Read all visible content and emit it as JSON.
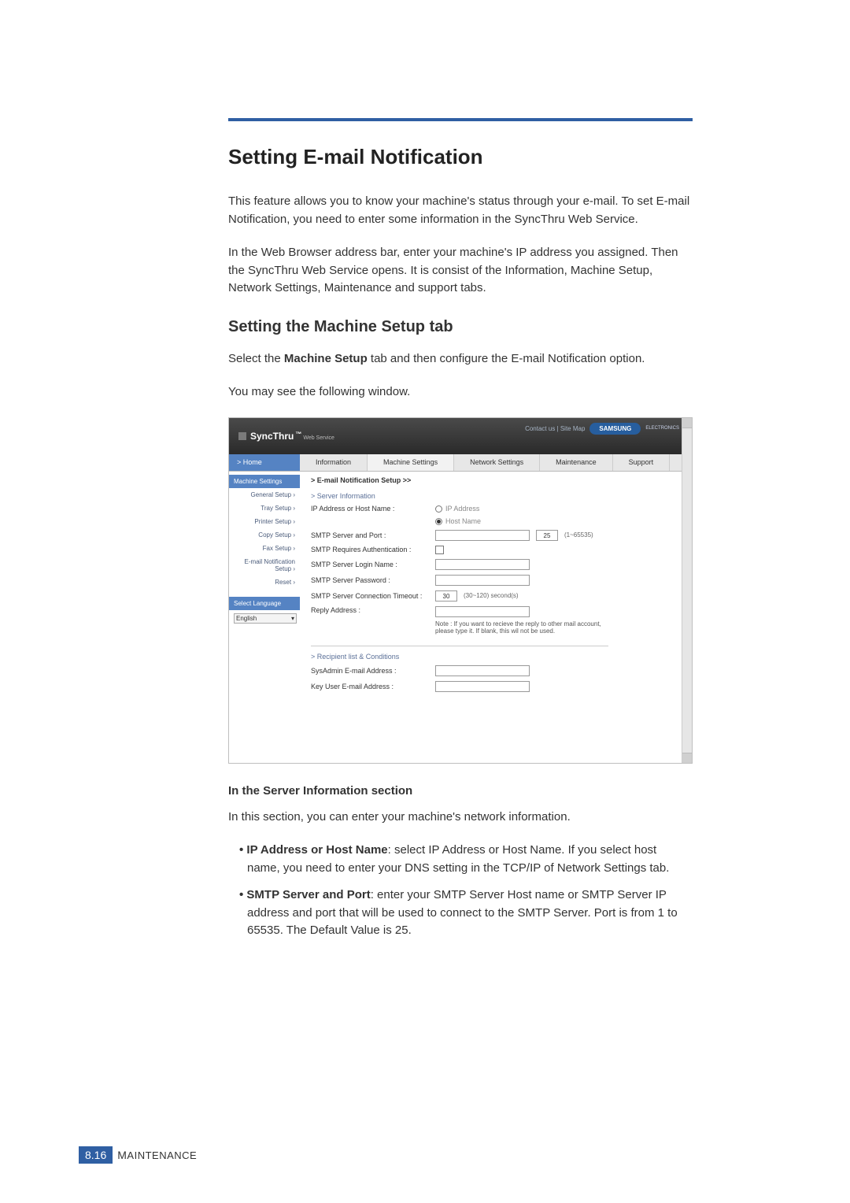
{
  "page": {
    "title": "Setting E-mail Notification",
    "intro1": "This feature allows you to know your machine's status through your e-mail. To set E-mail Notification, you need to enter some information in the SyncThru Web Service.",
    "intro2": "In the Web Browser address bar, enter your machine's IP address you assigned. Then the SyncThru Web Service opens. It is consist of the Information, Machine Setup, Network Settings, Maintenance and support tabs.",
    "section_title": "Setting the Machine Setup tab",
    "section_p1_a": "Select the ",
    "section_p1_b": "Machine Setup",
    "section_p1_c": " tab and then configure the E-mail Notification option.",
    "section_p2": "You may see the following window.",
    "sub_title": "In the Server Information section",
    "sub_p": "In this section, you can enter your machine's network information.",
    "bullet1_b": "IP Address or Host Name",
    "bullet1_r": ": select IP Address or Host Name. If you select host name, you need to enter your DNS setting in the TCP/IP of Network Settings tab.",
    "bullet2_b": "SMTP Server and Port",
    "bullet2_r": ": enter your SMTP Server Host name or SMTP Server IP address and port that will be used to connect to the SMTP Server. Port is from 1 to 65535. The Default Value is 25."
  },
  "footer": {
    "page_num": "8.16",
    "label_cap": "M",
    "label_rest": "AINTENANCE"
  },
  "shot": {
    "logo_main": "SyncThru",
    "logo_tm": "™",
    "logo_sub": "Web Service",
    "top_links": "Contact us   |   Site Map",
    "samsung": "SAMSUNG",
    "ewn": "ELECTRONICS",
    "home": "> Home",
    "tabs": [
      "Information",
      "Machine Settings",
      "Network Settings",
      "Maintenance",
      "Support"
    ],
    "side_head": "Machine Settings",
    "side_items": [
      "General Setup ›",
      "Tray Setup ›",
      "Printer Setup ›",
      "Copy Setup ›",
      "Fax Setup ›",
      "E-mail Notification Setup ›",
      "Reset ›"
    ],
    "side_lang_head": "Select Language",
    "side_lang_value": "English",
    "main_title": "> E-mail Notification Setup >>",
    "grp1": "> Server Information",
    "f_ip_label": "IP Address or Host Name :",
    "opt_ip": "IP Address",
    "opt_host": "Host Name",
    "f_smtp_label": "SMTP Server and Port :",
    "f_smtp_port": "25",
    "f_smtp_range": "(1~65535)",
    "f_auth_label": "SMTP Requires Authentication :",
    "f_login_label": "SMTP Server Login Name :",
    "f_pwd_label": "SMTP Server Password :",
    "f_timeout_label": "SMTP Server Connection Timeout :",
    "f_timeout_val": "30",
    "f_timeout_range": "(30~120) second(s)",
    "f_reply_label": "Reply Address :",
    "f_reply_note": "Note : If you want to recieve the reply to other mail account, please type it. If blank, this wil not be used.",
    "grp2": "> Recipient list & Conditions",
    "f_sysadmin": "SysAdmin E-mail Address :",
    "f_keyuser": "Key User E-mail Address :"
  }
}
